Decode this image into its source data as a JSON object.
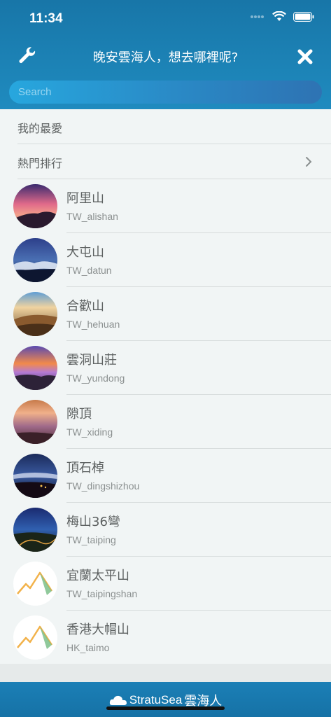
{
  "status": {
    "time": "11:34"
  },
  "nav": {
    "title": "晚安雲海人，想去哪裡呢?"
  },
  "search": {
    "placeholder": "Search"
  },
  "menu": [
    {
      "label": "我的最愛",
      "has_chevron": false
    },
    {
      "label": "熱門排行",
      "has_chevron": true
    }
  ],
  "places": [
    {
      "name": "阿里山",
      "code": "TW_alishan",
      "thumb": "sunset-photo"
    },
    {
      "name": "大屯山",
      "code": "TW_datun",
      "thumb": "night-sea-of-clouds-photo"
    },
    {
      "name": "合歡山",
      "code": "TW_hehuan",
      "thumb": "mountain-ridge-photo"
    },
    {
      "name": "雲洞山莊",
      "code": "TW_yundong",
      "thumb": "purple-sea-of-clouds-photo"
    },
    {
      "name": "隙頂",
      "code": "TW_xiding",
      "thumb": "dusk-clouds-photo"
    },
    {
      "name": "頂石棹",
      "code": "TW_dingshizhou",
      "thumb": "night-valley-photo"
    },
    {
      "name": "梅山36彎",
      "code": "TW_taiping",
      "thumb": "mountain-road-photo"
    },
    {
      "name": "宜蘭太平山",
      "code": "TW_taipingshan",
      "thumb": "mountain-logo-placeholder"
    },
    {
      "name": "香港大帽山",
      "code": "HK_taimo",
      "thumb": "mountain-logo-placeholder"
    }
  ],
  "footer": {
    "brand_en": "StratuSea",
    "brand_zh": "雲海人"
  },
  "colors": {
    "header": "#1876a8",
    "search": "#27a7de",
    "text": "#5d6161",
    "subtext": "#8b9090"
  }
}
